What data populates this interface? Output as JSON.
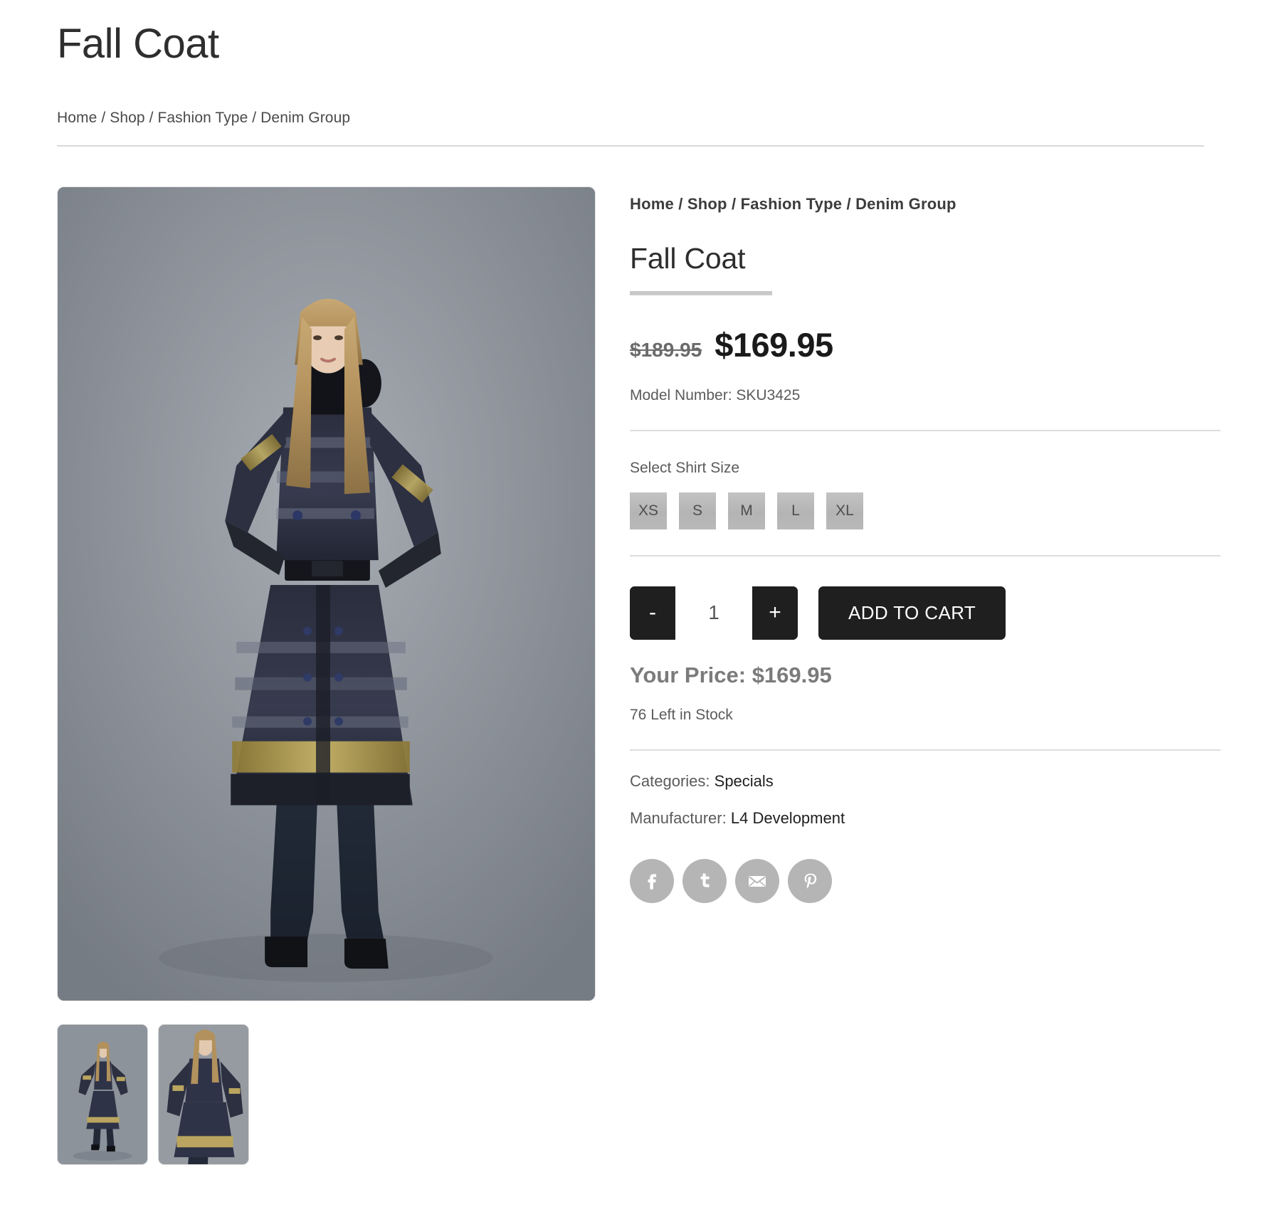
{
  "header": {
    "title": "Fall Coat",
    "breadcrumb": "Home / Shop / Fashion Type / Denim Group"
  },
  "product": {
    "breadcrumb": "Home / Shop / Fashion Type / Denim Group",
    "name": "Fall Coat",
    "price_original": "$189.95",
    "price_current": "$169.95",
    "model_number": "Model Number: SKU3425",
    "size_label": "Select Shirt Size",
    "sizes": [
      "XS",
      "S",
      "M",
      "L",
      "XL"
    ],
    "quantity": "1",
    "decrement_label": "-",
    "increment_label": "+",
    "add_to_cart_label": "ADD TO CART",
    "your_price": "Your Price: $169.95",
    "stock": "76 Left in Stock",
    "categories_label": "Categories:",
    "categories_value": "Specials",
    "manufacturer_label": "Manufacturer:",
    "manufacturer_value": "L4 Development"
  },
  "social": [
    {
      "name": "facebook-icon",
      "label": "f"
    },
    {
      "name": "twitter-icon",
      "label": "t"
    },
    {
      "name": "email-icon",
      "label": "email"
    },
    {
      "name": "pinterest-icon",
      "label": "p"
    }
  ],
  "colors": {
    "accent_bar": "#c9c9c9",
    "dark_button": "#1f1f1f",
    "size_button": "#b8b8b8",
    "social_circle": "#b5b5b5",
    "rule": "#dddddd",
    "text_primary": "#2e2e2e",
    "text_muted": "#5b5b5b"
  },
  "gallery": {
    "main_alt": "Model wearing Fall Coat front view",
    "thumbnails": [
      {
        "alt": "Fall Coat full body thumbnail"
      },
      {
        "alt": "Fall Coat detail thumbnail"
      }
    ]
  }
}
